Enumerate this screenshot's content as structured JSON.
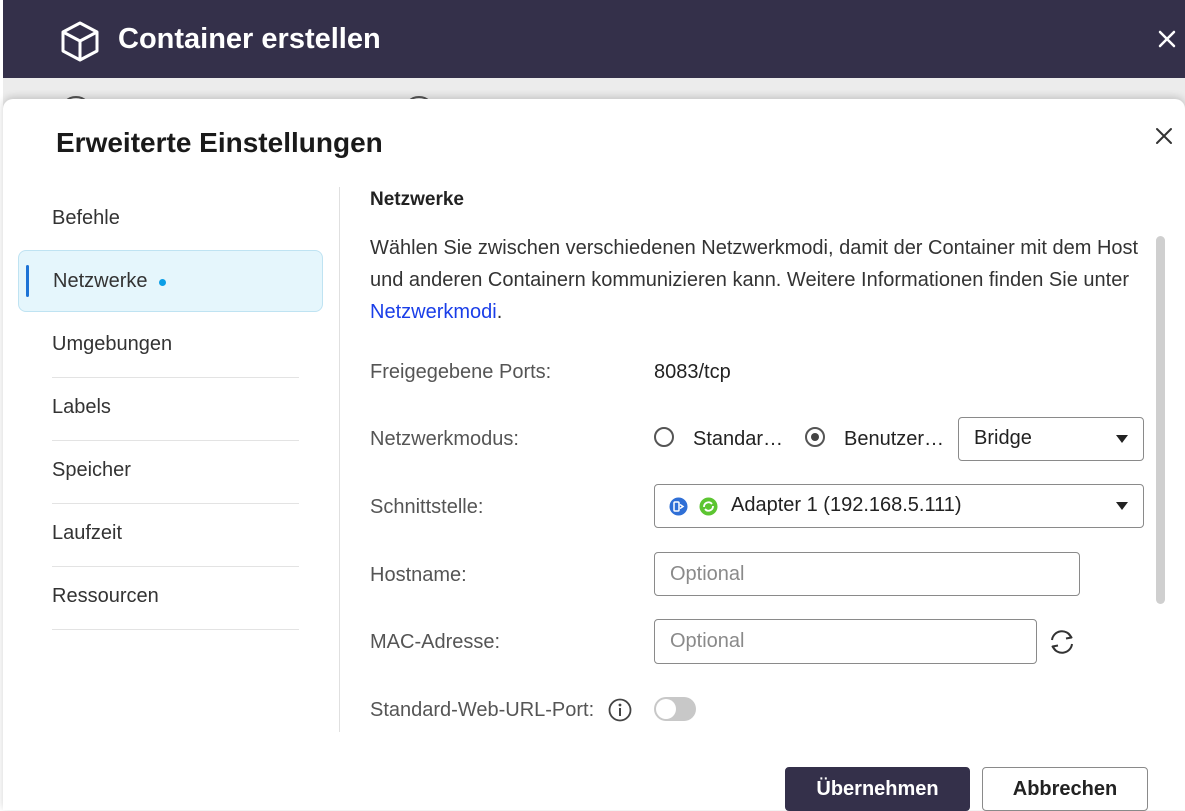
{
  "window": {
    "title": "Container erstellen",
    "close_icon": "close-icon"
  },
  "dialog": {
    "title": "Erweiterte Einstellungen",
    "sidebar": {
      "items": [
        {
          "label": "Befehle",
          "active": false
        },
        {
          "label": "Netzwerke",
          "active": true,
          "has_dot": true
        },
        {
          "label": "Umgebungen",
          "active": false
        },
        {
          "label": "Labels",
          "active": false
        },
        {
          "label": "Speicher",
          "active": false
        },
        {
          "label": "Laufzeit",
          "active": false
        },
        {
          "label": "Ressourcen",
          "active": false
        }
      ]
    },
    "main": {
      "section_title": "Netzwerke",
      "description_text": "Wählen Sie zwischen verschiedenen Netzwerkmodi, damit der Container mit dem Host und anderen Containern kommunizieren kann. Weitere Informationen finden Sie unter ",
      "description_link": "Netzwerkmodi",
      "description_end": ".",
      "ports": {
        "label": "Freigegebene Ports:",
        "value": "8083/tcp"
      },
      "network_mode": {
        "label": "Netzwerkmodus:",
        "option_standard": "Standar…",
        "option_custom": "Benutzer…",
        "selected": "custom",
        "select_value": "Bridge"
      },
      "interface": {
        "label": "Schnittstelle:",
        "value": "Adapter 1 (192.168.5.111)"
      },
      "hostname": {
        "label": "Hostname:",
        "placeholder": "Optional",
        "value": ""
      },
      "mac": {
        "label": "MAC-Adresse:",
        "placeholder": "Optional",
        "value": ""
      },
      "web_url_port": {
        "label": "Standard-Web-URL-Port:",
        "enabled": false
      }
    },
    "footer": {
      "apply_label": "Übernehmen",
      "cancel_label": "Abbrechen"
    }
  },
  "colors": {
    "titlebar": "#34304a",
    "accent_blue": "#1d73d6",
    "active_bg": "#e5f6fc",
    "link": "#1a3ee8",
    "status_dot": "#0a9ee6",
    "adapter_green": "#5cc531"
  }
}
